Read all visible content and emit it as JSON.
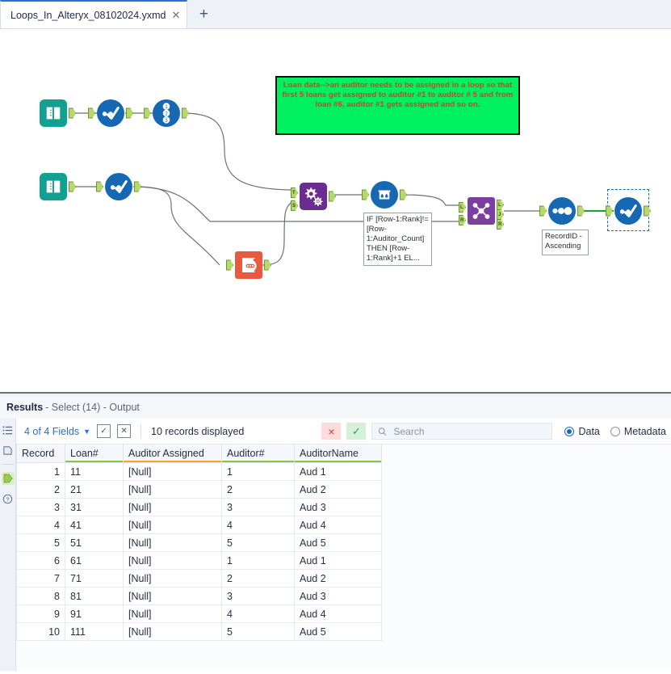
{
  "tab": {
    "title": "Loops_In_Alteryx_08102024.yxmd",
    "close_icon": "close-icon",
    "new_tab_icon": "plus-icon"
  },
  "canvas": {
    "comment": "Loan data-->an auditor needs to be assigned in a loop so that first 5 loans get assigned to auditor #1 to auditor # 5 and from loan #6, auditor #1 gets assigned and so on.",
    "comment_bg": "#00F060",
    "comment_color": "#E8352B",
    "tools": [
      {
        "id": "input1",
        "name": "input-data-tool",
        "type": "Input Data"
      },
      {
        "id": "select1",
        "name": "select-tool",
        "type": "Select"
      },
      {
        "id": "recordid1",
        "name": "record-id-tool",
        "type": "Record ID"
      },
      {
        "id": "input2",
        "name": "input-data-tool",
        "type": "Input Data"
      },
      {
        "id": "select2",
        "name": "select-tool",
        "type": "Select"
      },
      {
        "id": "summarize1",
        "name": "summarize-tool",
        "type": "Summarize"
      },
      {
        "id": "append1",
        "name": "append-fields-tool",
        "type": "Append Fields"
      },
      {
        "id": "multirow1",
        "name": "multi-row-formula-tool",
        "type": "Multi-Row Formula"
      },
      {
        "id": "join1",
        "name": "join-tool",
        "type": "Join"
      },
      {
        "id": "sort1",
        "name": "sort-tool",
        "type": "Sort"
      },
      {
        "id": "select3",
        "name": "select-tool-selected",
        "type": "Select"
      }
    ],
    "formula_note": "IF [Row-1:Rank]!=[Row-1:Auditor_Count] THEN [Row-1:Rank]+1 EL...",
    "sort_note": "RecordID - Ascending",
    "anchor_labels": {
      "append_t": "T",
      "append_s": "S",
      "join_l_in": "L",
      "join_r_in": "R",
      "join_l_out": "L",
      "join_j_out": "J",
      "join_r_out": "R"
    }
  },
  "results": {
    "title_bold": "Results",
    "title_rest": " - Select (14) - Output",
    "toolbar": {
      "fields_label": "4 of 4 Fields",
      "chevron": "chevron-down-icon",
      "check_all_icon": "check-box-icon",
      "uncheck_all_icon": "x-box-icon",
      "records_displayed": "10 records displayed",
      "close_label": "×",
      "confirm_label": "✓",
      "search_placeholder": "Search",
      "search_value": "",
      "search_icon": "search-icon",
      "radio_data": "Data",
      "radio_metadata": "Metadata",
      "radio_selected": "Data"
    },
    "sidebar_icons": [
      "list-icon",
      "panel-icon",
      "output-anchor-icon",
      "help-icon"
    ],
    "table": {
      "columns": [
        {
          "label": "Record",
          "underline": "none"
        },
        {
          "label": "Loan#",
          "underline": "green"
        },
        {
          "label": "Auditor Assigned",
          "underline": "orange"
        },
        {
          "label": "Auditor#",
          "underline": "green"
        },
        {
          "label": "AuditorName",
          "underline": "green"
        }
      ],
      "rows": [
        [
          "1",
          "11",
          "[Null]",
          "1",
          "Aud 1"
        ],
        [
          "2",
          "21",
          "[Null]",
          "2",
          "Aud 2"
        ],
        [
          "3",
          "31",
          "[Null]",
          "3",
          "Aud 3"
        ],
        [
          "4",
          "41",
          "[Null]",
          "4",
          "Aud 4"
        ],
        [
          "5",
          "51",
          "[Null]",
          "5",
          "Aud 5"
        ],
        [
          "6",
          "61",
          "[Null]",
          "1",
          "Aud 1"
        ],
        [
          "7",
          "71",
          "[Null]",
          "2",
          "Aud 2"
        ],
        [
          "8",
          "81",
          "[Null]",
          "3",
          "Aud 3"
        ],
        [
          "9",
          "91",
          "[Null]",
          "4",
          "Aud 4"
        ],
        [
          "10",
          "111",
          "[Null]",
          "5",
          "Aud 5"
        ]
      ]
    }
  }
}
